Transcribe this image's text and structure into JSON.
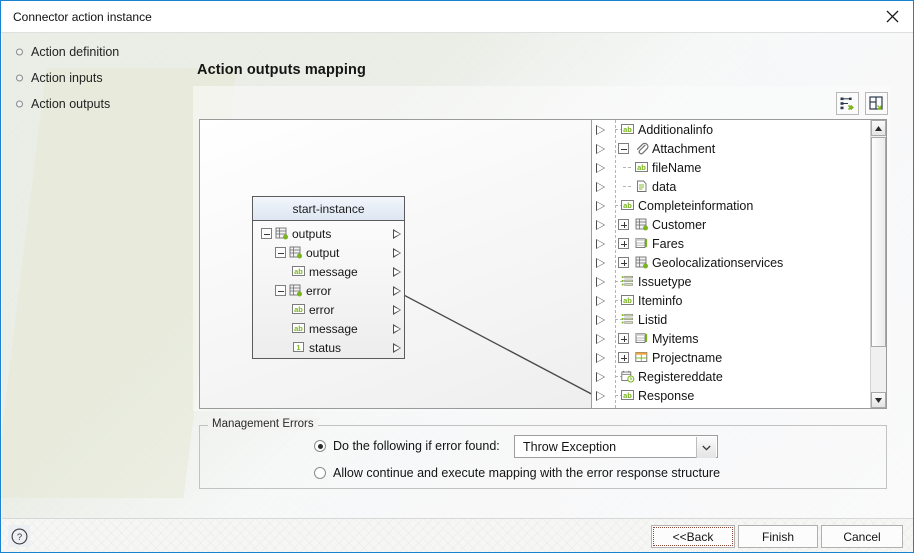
{
  "window": {
    "title": "Connector action instance",
    "close_icon": "close-icon"
  },
  "sidebar": {
    "items": [
      {
        "label": "Action definition"
      },
      {
        "label": "Action inputs"
      },
      {
        "label": "Action outputs"
      }
    ]
  },
  "page": {
    "heading": "Action outputs mapping"
  },
  "toolbar": {
    "buttons": [
      {
        "icon": "auto-map-icon",
        "tooltip": "Auto map"
      },
      {
        "icon": "layout-panels-icon",
        "tooltip": "Arrange panels"
      }
    ]
  },
  "source_node": {
    "title": "start-instance",
    "rows": [
      {
        "label": "outputs",
        "indent": 0,
        "toggle": "minus",
        "icon": "structure-icon"
      },
      {
        "label": "output",
        "indent": 1,
        "toggle": "minus",
        "icon": "structure-icon"
      },
      {
        "label": "message",
        "indent": 2,
        "toggle": "none",
        "icon": "string-icon"
      },
      {
        "label": "error",
        "indent": 1,
        "toggle": "minus",
        "icon": "structure-icon"
      },
      {
        "label": "error",
        "indent": 2,
        "toggle": "none",
        "icon": "string-icon"
      },
      {
        "label": "message",
        "indent": 2,
        "toggle": "none",
        "icon": "string-icon"
      },
      {
        "label": "status",
        "indent": 2,
        "toggle": "none",
        "icon": "number-icon"
      }
    ]
  },
  "target_tree": {
    "rows": [
      {
        "label": "Additionalinfo",
        "indent": 0,
        "toggle": "none",
        "icon": "string-icon"
      },
      {
        "label": "Attachment",
        "indent": 0,
        "toggle": "minus",
        "icon": "attachment-icon"
      },
      {
        "label": "fileName",
        "indent": 1,
        "toggle": "none",
        "icon": "string-icon"
      },
      {
        "label": "data",
        "indent": 1,
        "toggle": "none",
        "icon": "document-icon"
      },
      {
        "label": "Completeinformation",
        "indent": 0,
        "toggle": "none",
        "icon": "string-icon"
      },
      {
        "label": "Customer",
        "indent": 0,
        "toggle": "plus",
        "icon": "structure-icon"
      },
      {
        "label": "Fares",
        "indent": 0,
        "toggle": "plus",
        "icon": "table-icon"
      },
      {
        "label": "Geolocalizationservices",
        "indent": 0,
        "toggle": "plus",
        "icon": "structure-icon"
      },
      {
        "label": "Issuetype",
        "indent": 0,
        "toggle": "none",
        "icon": "list-icon"
      },
      {
        "label": "Iteminfo",
        "indent": 0,
        "toggle": "none",
        "icon": "string-icon"
      },
      {
        "label": "Listid",
        "indent": 0,
        "toggle": "none",
        "icon": "list-icon"
      },
      {
        "label": "Myitems",
        "indent": 0,
        "toggle": "plus",
        "icon": "table-icon"
      },
      {
        "label": "Projectname",
        "indent": 0,
        "toggle": "plus",
        "icon": "grid-icon"
      },
      {
        "label": "Registereddate",
        "indent": 0,
        "toggle": "none",
        "icon": "date-icon"
      },
      {
        "label": "Response",
        "indent": 0,
        "toggle": "none",
        "icon": "string-icon"
      }
    ]
  },
  "mapping": {
    "connections": [
      {
        "from": "message",
        "to": "Response"
      }
    ]
  },
  "management_errors": {
    "legend": "Management Errors",
    "option_error_found": "Do the following if error found:",
    "option_allow_continue": "Allow continue and execute mapping with the error response structure",
    "selected": "error_found",
    "action_select": {
      "value": "Throw Exception",
      "options": [
        "Throw Exception"
      ]
    }
  },
  "footer": {
    "help_icon": "help-icon",
    "back_label": "<<Back",
    "finish_label": "Finish",
    "cancel_label": "Cancel"
  },
  "colors": {
    "accent": "#1982d1",
    "node_header": "#dde6f2",
    "icon_green": "#7ab51d"
  }
}
